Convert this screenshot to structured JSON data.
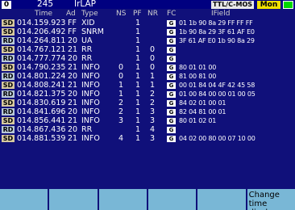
{
  "topbar": {
    "channel": "0",
    "count": "245",
    "protocol": "IrLAP",
    "signal_mode": "TTL/C-MOS",
    "mode": "Mon"
  },
  "columns": {
    "time": "Time",
    "ad": "Ad",
    "type": "Type",
    "ns": "NS",
    "pf": "PF",
    "nr": "NR",
    "fc": "FC",
    "ifield": "IField"
  },
  "rows": [
    {
      "dir": "SD",
      "time": "014.159.923",
      "ad": "FF",
      "type": "XID",
      "ns": "",
      "pf": "1",
      "nr": "",
      "fc": true,
      "data": "01 1b 90 8a 29 FF FF FF"
    },
    {
      "dir": "SD",
      "time": "014.206.492",
      "ad": "FF",
      "type": "SNRM",
      "ns": "",
      "pf": "1",
      "nr": "",
      "fc": true,
      "data": "1b 90 8a 29 3F 61 AF E0"
    },
    {
      "dir": "RD",
      "time": "014.264.811",
      "ad": "20",
      "type": "UA",
      "ns": "",
      "pf": "1",
      "nr": "",
      "fc": true,
      "data": "3F 61 AF E0 1b 90 8a 29"
    },
    {
      "dir": "SD",
      "time": "014.767.121",
      "ad": "21",
      "type": "RR",
      "ns": "",
      "pf": "1",
      "nr": "0",
      "fc": true,
      "data": ""
    },
    {
      "dir": "RD",
      "time": "014.777.774",
      "ad": "20",
      "type": "RR",
      "ns": "",
      "pf": "1",
      "nr": "0",
      "fc": true,
      "data": ""
    },
    {
      "dir": "SD",
      "time": "014.790.235",
      "ad": "21",
      "type": "INFO",
      "ns": "0",
      "pf": "1",
      "nr": "0",
      "fc": true,
      "data": "80 01 01 00"
    },
    {
      "dir": "RD",
      "time": "014.801.224",
      "ad": "20",
      "type": "INFO",
      "ns": "0",
      "pf": "1",
      "nr": "1",
      "fc": true,
      "data": "81 00 81 00"
    },
    {
      "dir": "SD",
      "time": "014.808.241",
      "ad": "21",
      "type": "INFO",
      "ns": "1",
      "pf": "1",
      "nr": "1",
      "fc": true,
      "data": "00 01 84 04 4F 42 45 58"
    },
    {
      "dir": "RD",
      "time": "014.821.375",
      "ad": "20",
      "type": "INFO",
      "ns": "1",
      "pf": "1",
      "nr": "2",
      "fc": true,
      "data": "01 00 84 00 00 01 00 05"
    },
    {
      "dir": "SD",
      "time": "014.830.619",
      "ad": "21",
      "type": "INFO",
      "ns": "2",
      "pf": "1",
      "nr": "2",
      "fc": true,
      "data": "84 02 01 00 01"
    },
    {
      "dir": "RD",
      "time": "014.841.696",
      "ad": "20",
      "type": "INFO",
      "ns": "2",
      "pf": "1",
      "nr": "3",
      "fc": true,
      "data": "82 04 81 00 01"
    },
    {
      "dir": "SD",
      "time": "014.856.441",
      "ad": "21",
      "type": "INFO",
      "ns": "3",
      "pf": "1",
      "nr": "3",
      "fc": true,
      "data": "80 01 02 01"
    },
    {
      "dir": "RD",
      "time": "014.867.436",
      "ad": "20",
      "type": "RR",
      "ns": "",
      "pf": "1",
      "nr": "4",
      "fc": true,
      "data": ""
    },
    {
      "dir": "SD",
      "time": "014.881.539",
      "ad": "21",
      "type": "INFO",
      "ns": "4",
      "pf": "1",
      "nr": "3",
      "fc": true,
      "data": "04 02 00 80 00 07 10 00"
    }
  ],
  "fc_icon_label": "G",
  "softkeys": [
    {
      "label": ""
    },
    {
      "label": ""
    },
    {
      "label": ""
    },
    {
      "label": ""
    },
    {
      "label": ""
    },
    {
      "label": "Change time display"
    }
  ],
  "colors": {
    "background": "#10107a",
    "softkey": "#79b7d6",
    "mon_badge": "#f0e000",
    "status_green": "#00d800"
  }
}
